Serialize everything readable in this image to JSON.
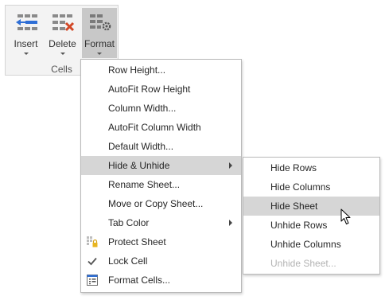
{
  "ribbon": {
    "insert_label": "Insert",
    "delete_label": "Delete",
    "format_label": "Format",
    "group_label": "Cells",
    "icons": {
      "insert": "insert-cells-icon",
      "delete": "delete-cells-icon",
      "format": "format-cells-gear-icon"
    },
    "colors": {
      "insert_accent": "#2f6fd6",
      "delete_accent": "#d24726",
      "active_button": "#c8c8c8"
    }
  },
  "format_menu": {
    "items": [
      {
        "label": "Row Height..."
      },
      {
        "label": "AutoFit Row Height"
      },
      {
        "label": "Column Width..."
      },
      {
        "label": "AutoFit Column Width"
      },
      {
        "label": "Default Width..."
      },
      {
        "label": "Hide & Unhide",
        "submenu": true,
        "highlighted": true
      },
      {
        "label": "Rename Sheet..."
      },
      {
        "label": "Move or Copy Sheet..."
      },
      {
        "label": "Tab Color",
        "submenu": true
      },
      {
        "label": "Protect Sheet",
        "icon": "protect-sheet-lock-icon"
      },
      {
        "label": "Lock Cell",
        "icon": "checkmark-icon"
      },
      {
        "label": "Format Cells...",
        "icon": "format-cells-dialog-icon"
      }
    ]
  },
  "hide_unhide_menu": {
    "items": [
      {
        "label": "Hide Rows"
      },
      {
        "label": "Hide Columns"
      },
      {
        "label": "Hide Sheet",
        "highlighted": true
      },
      {
        "label": "Unhide Rows"
      },
      {
        "label": "Unhide Columns"
      },
      {
        "label": "Unhide Sheet...",
        "disabled": true
      }
    ]
  },
  "colors": {
    "highlight": "#d6d6d6",
    "disabled_text": "#b3b3b3"
  }
}
